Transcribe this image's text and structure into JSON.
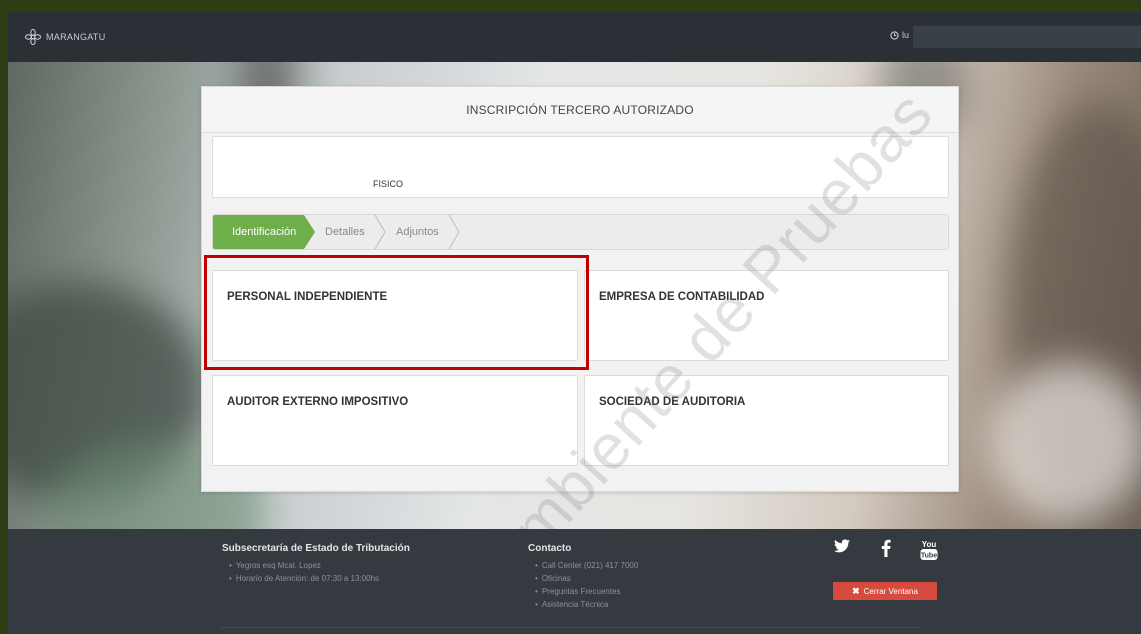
{
  "app": {
    "name": "MARANGATU",
    "session_prefix": "lu"
  },
  "panel": {
    "title": "INSCRIPCIÓN TERCERO AUTORIZADO",
    "person_type": "FISICO"
  },
  "steps": [
    {
      "label": "Identificación",
      "active": true
    },
    {
      "label": "Detalles",
      "active": false
    },
    {
      "label": "Adjuntos",
      "active": false
    }
  ],
  "options": [
    {
      "label": "PERSONAL INDEPENDIENTE",
      "highlighted": true
    },
    {
      "label": "EMPRESA DE CONTABILIDAD",
      "highlighted": false
    },
    {
      "label": "AUDITOR EXTERNO IMPOSITIVO",
      "highlighted": false
    },
    {
      "label": "SOCIEDAD DE AUDITORIA",
      "highlighted": false
    }
  ],
  "watermark": "Ambiente de Pruebas",
  "footer": {
    "org": {
      "title": "Subsecretaría de Estado de Tributación",
      "items": [
        "Yegros esq Mcal. Lopez",
        "Horario de Atención: de 07:30 a 13:00hs"
      ]
    },
    "contact": {
      "title": "Contacto",
      "items": [
        "Call Center (021) 417 7000",
        "Oficinas",
        "Preguntas Frecuentes",
        "Asistencia Técnica"
      ]
    },
    "social": [
      {
        "icon": "twitter-icon"
      },
      {
        "icon": "facebook-icon"
      },
      {
        "icon": "youtube-icon",
        "text_top": "You",
        "text_bottom": "Tube"
      }
    ],
    "close_button": "Cerrar Ventana"
  },
  "colors": {
    "active_step": "#6eae4b",
    "highlight_border": "#c00000",
    "close_button": "#d64a3f",
    "topbar": "#2b3036",
    "footer": "#353a40"
  }
}
